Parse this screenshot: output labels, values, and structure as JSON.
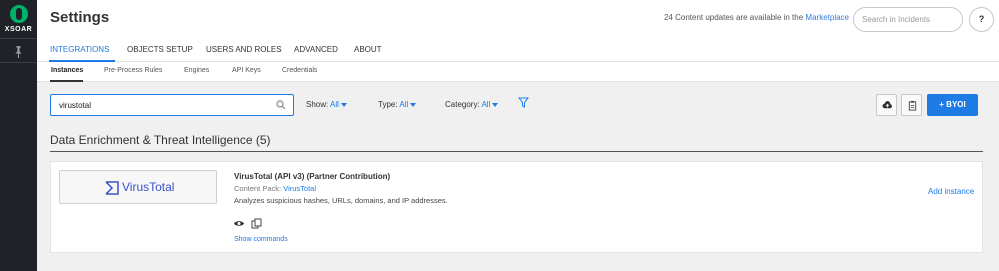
{
  "rail": {
    "logo_text": "XSOAR"
  },
  "header": {
    "title": "Settings",
    "updates_prefix": "24 Content updates are available in the",
    "updates_link": "Marketplace",
    "search_placeholder": "Search in Incidents",
    "help_label": "?"
  },
  "tabs": [
    "INTEGRATIONS",
    "OBJECTS SETUP",
    "USERS AND ROLES",
    "ADVANCED",
    "ABOUT"
  ],
  "subtabs": [
    "Instances",
    "Pre-Process Rules",
    "Engines",
    "API Keys",
    "Credentials"
  ],
  "filter": {
    "search_value": "virustotal",
    "show_label": "Show:",
    "show_value": "All",
    "type_label": "Type:",
    "type_value": "All",
    "category_label": "Category:",
    "category_value": "All"
  },
  "actions": {
    "byoi_label": "BYOI"
  },
  "section": {
    "title": "Data Enrichment & Threat Intelligence (5)"
  },
  "integration": {
    "logo_text": "VirusTotal",
    "title": "VirusTotal (API v3) (Partner Contribution)",
    "pack_label": "Content Pack:",
    "pack_name": "VirusTotal",
    "description": "Analyzes suspicious hashes, URLs, domains, and IP addresses.",
    "show_commands": "Show commands",
    "add_instance": "Add instance"
  },
  "colors": {
    "accent": "#1e7be4",
    "rail": "#1f2226",
    "brand_green": "#00b16a",
    "virustotal_blue": "#3a53c9"
  },
  "icons": [
    "xsoar-logo-icon",
    "pin-icon",
    "search-icon",
    "filter-icon",
    "cloud-upload-icon",
    "clipboard-icon",
    "plus-icon",
    "virustotal-logo-icon",
    "eye-icon",
    "copy-icon"
  ]
}
